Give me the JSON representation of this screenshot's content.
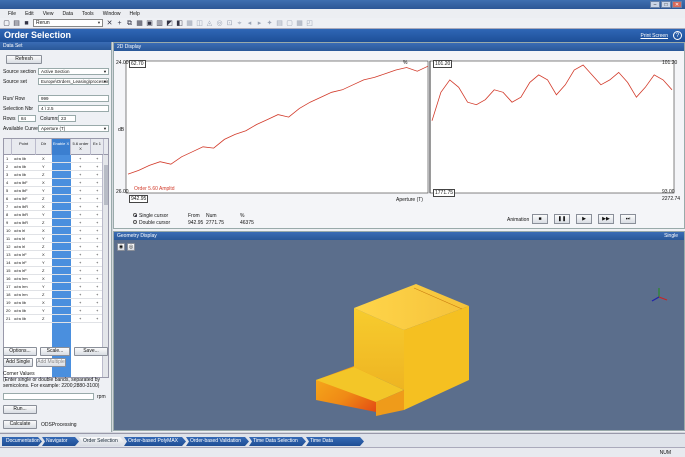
{
  "window": {
    "controls": [
      "–",
      "□",
      "✕"
    ]
  },
  "menu": [
    "File",
    "Edit",
    "View",
    "Data",
    "Tools",
    "Window",
    "Help"
  ],
  "toolbar": {
    "combo_value": "Rerun"
  },
  "header": {
    "title": "Order Selection",
    "print": "Print Screen",
    "help": "?"
  },
  "left": {
    "panel_title": "Data Set",
    "refresh": "Refresh",
    "source_section_label": "Source section",
    "source_section_value": "Active Section",
    "source_set_label": "Source set",
    "source_set_value": "Europe\\Orders_Leasing\\processing_in",
    "run_row_label": "Run/ Row",
    "run_row_value": "999",
    "selection_label": "Selection Nbr",
    "selection_value": "4 \\ 2.5",
    "rows_label": "Rows",
    "rows_value": "84",
    "columns_label": "Columns",
    "columns_value": "23",
    "available_label": "Available Curves",
    "available_value": "Aperture (T)",
    "table_headers": [
      "",
      "Point",
      "Dir",
      "Enable\nX",
      "5.6 order\nX",
      "Ex\n1"
    ],
    "table_rows": [
      {
        "n": "1",
        "point": "o/ra lib",
        "dir": "X",
        "a": "",
        "b": "+",
        "c": "+"
      },
      {
        "n": "2",
        "point": "o/ra lib",
        "dir": "Y",
        "a": "",
        "b": "+",
        "c": "+"
      },
      {
        "n": "3",
        "point": "o/ra lib",
        "dir": "Z",
        "a": "",
        "b": "+",
        "c": "+"
      },
      {
        "n": "4",
        "point": "o/ra lbF",
        "dir": "X",
        "a": "",
        "b": "+",
        "c": "+"
      },
      {
        "n": "5",
        "point": "o/ra lbF",
        "dir": "Y",
        "a": "",
        "b": "+",
        "c": "+"
      },
      {
        "n": "6",
        "point": "o/ra lbF",
        "dir": "Z",
        "a": "",
        "b": "+",
        "c": "+"
      },
      {
        "n": "7",
        "point": "o/ra lbR",
        "dir": "X",
        "a": "",
        "b": "+",
        "c": "+"
      },
      {
        "n": "8",
        "point": "o/ra lbR",
        "dir": "Y",
        "a": "",
        "b": "+",
        "c": "+"
      },
      {
        "n": "9",
        "point": "o/ra lbR",
        "dir": "Z",
        "a": "",
        "b": "+",
        "c": "+"
      },
      {
        "n": "10",
        "point": "o/ra lrl",
        "dir": "X",
        "a": "",
        "b": "+",
        "c": "+"
      },
      {
        "n": "11",
        "point": "o/ra lrl",
        "dir": "Y",
        "a": "",
        "b": "+",
        "c": "+"
      },
      {
        "n": "12",
        "point": "o/ra lrl",
        "dir": "Z",
        "a": "",
        "b": "+",
        "c": "+"
      },
      {
        "n": "13",
        "point": "o/ra lrF",
        "dir": "X",
        "a": "",
        "b": "+",
        "c": "+"
      },
      {
        "n": "14",
        "point": "o/ra lrF",
        "dir": "Y",
        "a": "",
        "b": "+",
        "c": "+"
      },
      {
        "n": "15",
        "point": "o/ra lrF",
        "dir": "Z",
        "a": "",
        "b": "+",
        "c": "+"
      },
      {
        "n": "16",
        "point": "o/ra lrm",
        "dir": "X",
        "a": "",
        "b": "+",
        "c": "+"
      },
      {
        "n": "17",
        "point": "o/ra lrm",
        "dir": "Y",
        "a": "",
        "b": "+",
        "c": "+"
      },
      {
        "n": "18",
        "point": "o/ra lrm",
        "dir": "Z",
        "a": "",
        "b": "+",
        "c": "+"
      },
      {
        "n": "19",
        "point": "o/ra lib",
        "dir": "X",
        "a": "",
        "b": "+",
        "c": "+"
      },
      {
        "n": "20",
        "point": "o/ra lib",
        "dir": "Y",
        "a": "",
        "b": "+",
        "c": "+"
      },
      {
        "n": "21",
        "point": "o/ra lib",
        "dir": "Z",
        "a": "",
        "b": "+",
        "c": "+"
      }
    ],
    "options": "Options...",
    "scale": "Scale...",
    "save": "Save...",
    "add_single": "Add Single",
    "add_multiple": "Add Multiple",
    "corner_values_title": "Corner Values",
    "corner_values_hint": "(Enter single or double bands, separated by semicolons. For example: 2200;2880-3100)",
    "rpm_unit": "rpm",
    "run": "Run...",
    "calculate": "Calculate",
    "calculate_value": "ODSProcessing"
  },
  "chart": {
    "panel_title": "2D Display",
    "left_ymax": "24.00",
    "left_ymin": "26.00",
    "right_ymax": "101.20",
    "right_ymin": "93.00",
    "xlabel": "Aperture (T)",
    "left_top_box": "62.70",
    "right_top_box": "101.20",
    "y_unit_left": "dB",
    "y_unit_right": "%",
    "left_bottom_left": "942.95",
    "left_bottom_right": "1771.75",
    "right_bottom_right": "2272.74",
    "legend_text": "Order 5.60 Ampltd",
    "radio_single": "Single cursor",
    "radio_double": "Double cursor",
    "col_from": "From",
    "col_from_val": "942.95",
    "col_num": "Num",
    "col_num_val": "2771.75",
    "col_pct": "%",
    "col_pct_val": "46375",
    "animate_label": "Animation",
    "controls": [
      "■",
      "❚❚",
      "▶",
      "▶▶",
      "⏭"
    ]
  },
  "geometry": {
    "panel_title": "Geometry Display",
    "mode": "Single"
  },
  "nav": [
    "Documentation",
    "Navigator",
    "Order Selection",
    "Order-based PolyMAX",
    "Order-based Validation",
    "Time Data Selection",
    "Time Data Processing"
  ],
  "nav_active_index": 2,
  "status": {
    "right": "NUM"
  },
  "chart_data": {
    "type": "line",
    "series": [
      {
        "values_left": [
          12,
          15,
          19,
          22,
          20,
          26,
          30,
          34,
          33,
          40,
          44,
          47,
          52,
          56,
          60,
          58,
          65,
          70,
          74,
          78,
          80,
          84,
          88,
          90,
          93,
          96,
          98,
          95,
          99
        ],
        "values_right": [
          55,
          78,
          88,
          82,
          70,
          68,
          72,
          80,
          78,
          70,
          74,
          86,
          92,
          88,
          76,
          84,
          96,
          100,
          92,
          84,
          88,
          94,
          86,
          74,
          82,
          92,
          88,
          80
        ]
      }
    ]
  },
  "colors": {
    "accent": "#2a5898",
    "selected_col": "#4a8fde",
    "curve": "#d23a2a"
  }
}
